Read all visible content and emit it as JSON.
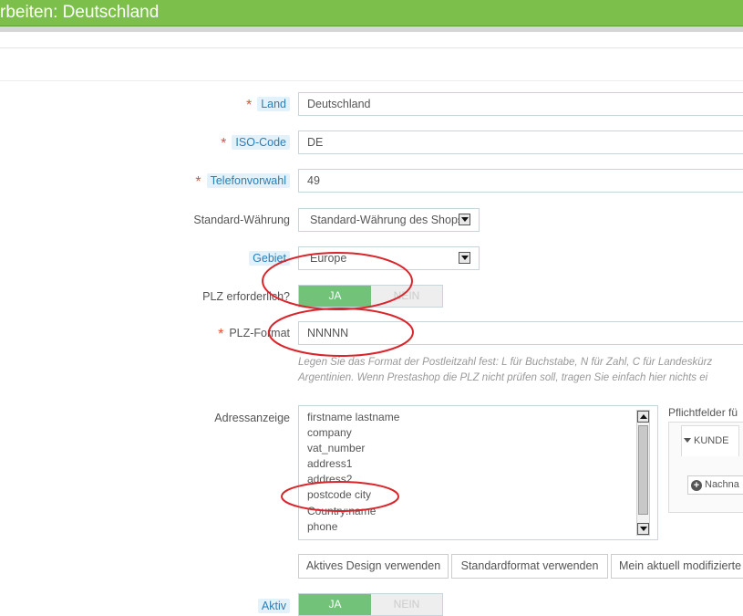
{
  "header": {
    "title": "rbeiten: Deutschland"
  },
  "form": {
    "land": {
      "label": "Land",
      "value": "Deutschland"
    },
    "iso": {
      "label": "ISO-Code",
      "value": "DE"
    },
    "telefon": {
      "label": "Telefonvorwahl",
      "value": "49"
    },
    "waehrung": {
      "label": "Standard-Währung",
      "value": "Standard-Währung des Shops"
    },
    "gebiet": {
      "label": "Gebiet",
      "value": "Europe"
    },
    "plz_required": {
      "label": "PLZ erforderlich?",
      "yes": "JA",
      "no": "NEIN"
    },
    "plz_format": {
      "label": "PLZ-Format",
      "value": "NNNNN",
      "help_line1": "Legen Sie das Format der Postleitzahl fest: L für Buchstabe, N für Zahl, C für Landeskürz",
      "help_line2": "Argentinien. Wenn Prestashop die PLZ nicht prüfen soll, tragen Sie einfach hier nichts ei"
    },
    "adressanzeige": {
      "label": "Adressanzeige",
      "lines": [
        "firstname lastname",
        "company",
        "vat_number",
        "address1",
        "address2",
        "postcode city",
        "Country:name",
        "phone"
      ]
    },
    "pflichtfelder": {
      "title": "Pflichtfelder fü",
      "tab": "KUNDE",
      "add_button": "Nachna"
    },
    "buttons": {
      "active_design": "Aktives Design verwenden",
      "default_format": "Standardformat verwenden",
      "current_modified": "Mein aktuell modifizierte"
    },
    "aktiv": {
      "label": "Aktiv",
      "yes": "JA",
      "no": "NEIN"
    }
  },
  "colors": {
    "header_green": "#7cc04b",
    "toggle_green": "#72c279",
    "required_star": "#e74c3c",
    "annotation_red": "#d9262c"
  }
}
